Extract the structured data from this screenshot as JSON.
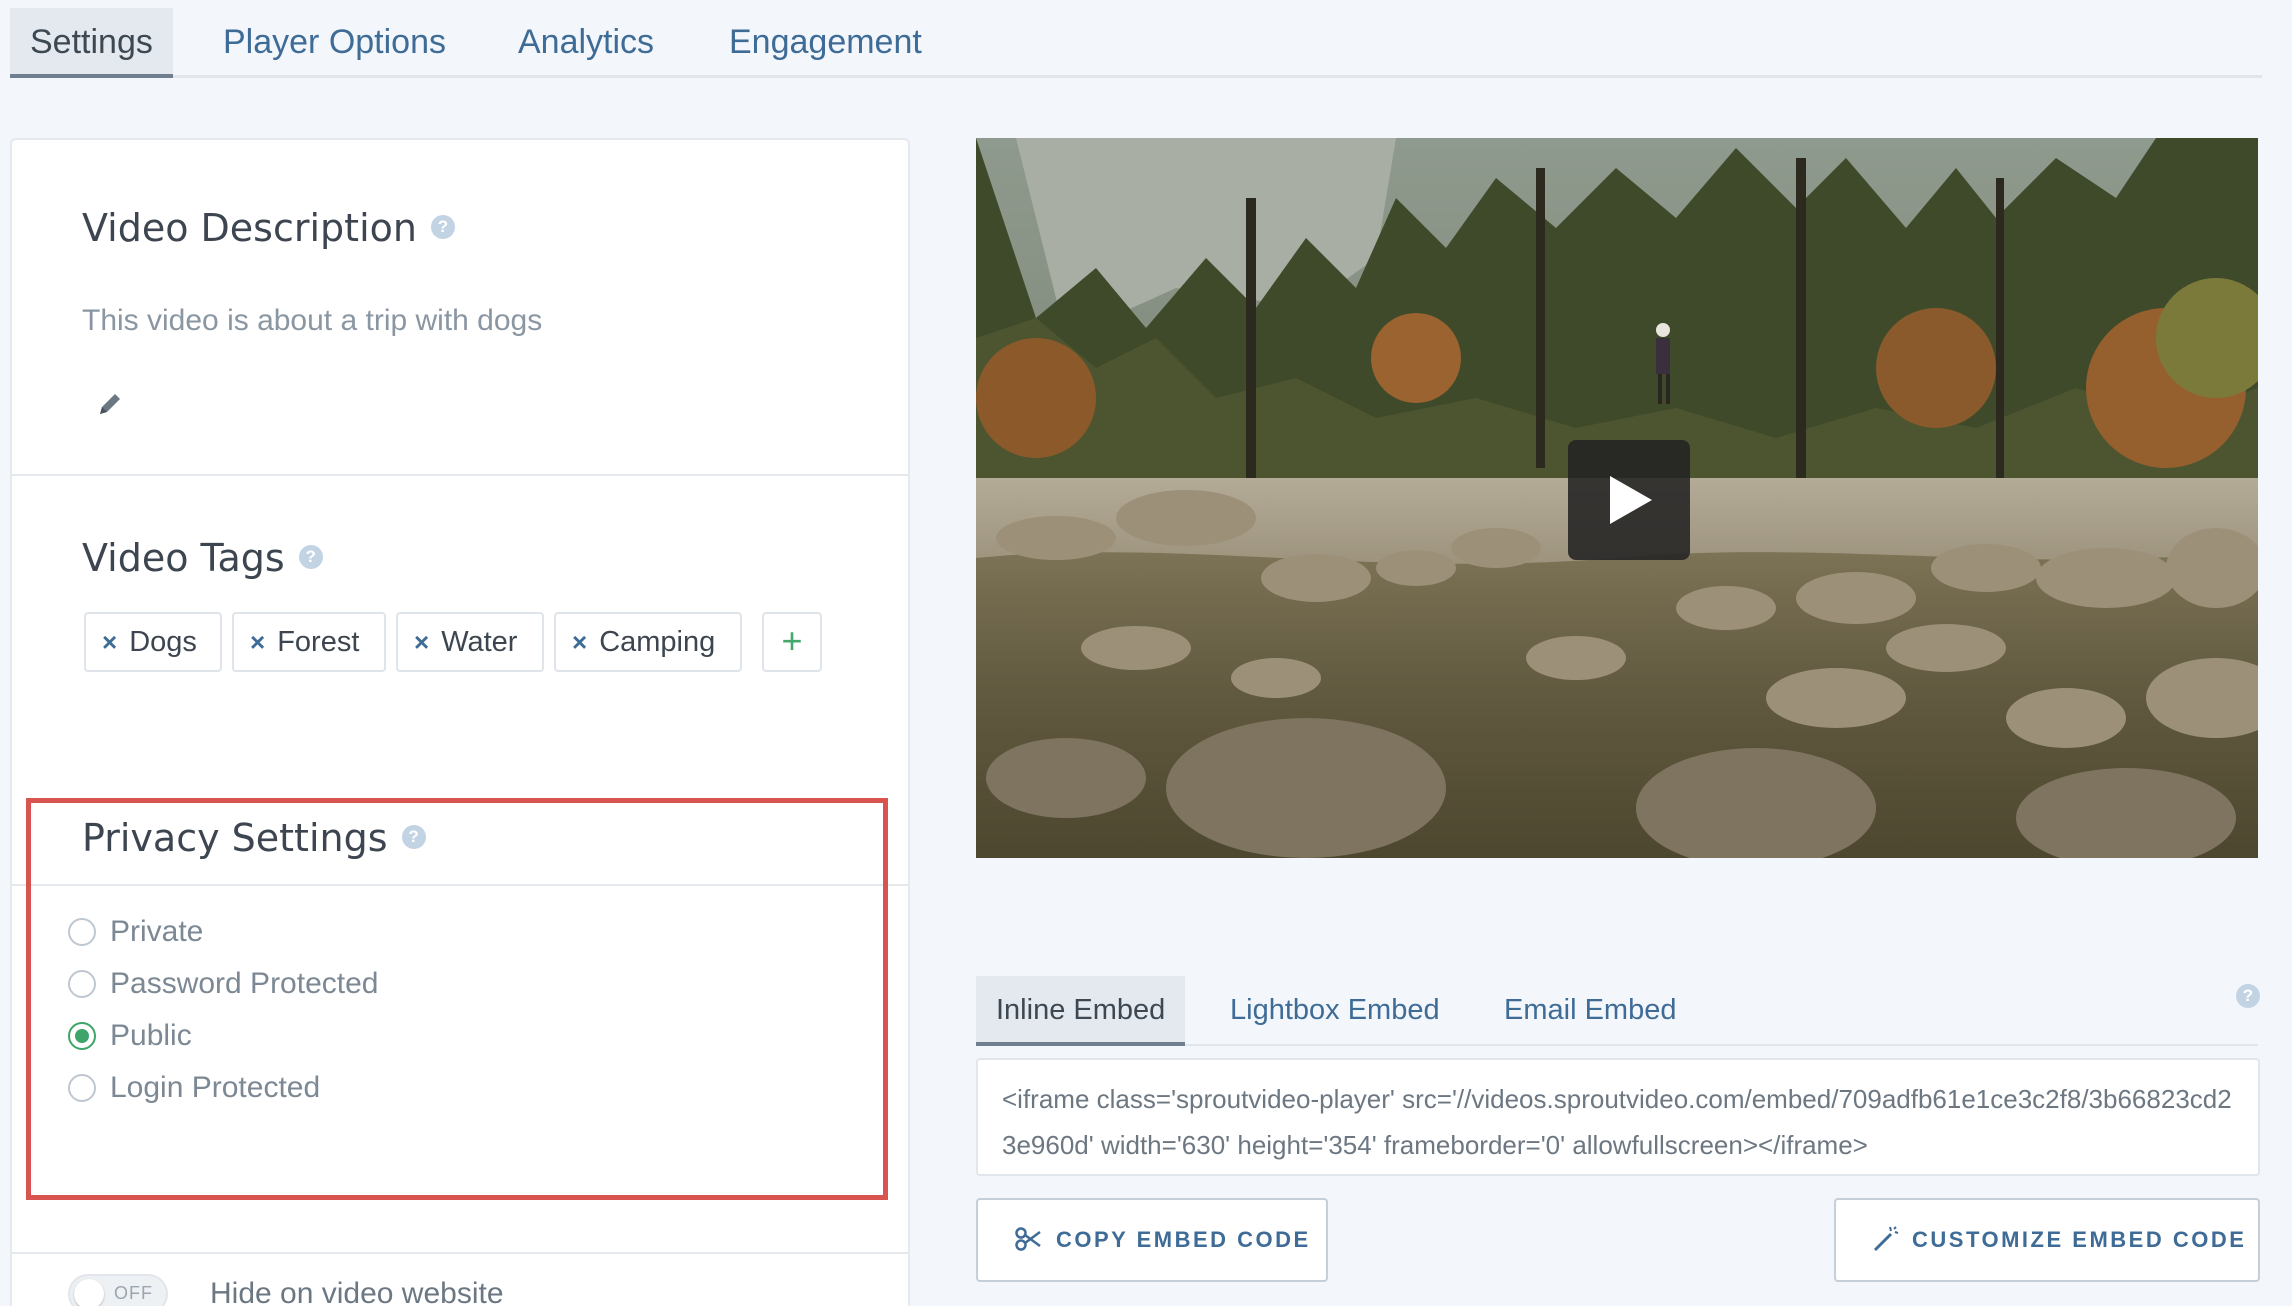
{
  "tabs": {
    "settings": "Settings",
    "player_options": "Player Options",
    "analytics": "Analytics",
    "engagement": "Engagement",
    "active": "Settings"
  },
  "description": {
    "title": "Video Description",
    "help": "?",
    "text": "This video is about a trip with dogs",
    "edit_icon": "pencil-icon"
  },
  "tags": {
    "title": "Video Tags",
    "help": "?",
    "remove_symbol": "×",
    "items": [
      "Dogs",
      "Forest",
      "Water",
      "Camping"
    ],
    "add_symbol": "+"
  },
  "privacy": {
    "title": "Privacy Settings",
    "help": "?",
    "options": [
      "Private",
      "Password Protected",
      "Public",
      "Login Protected"
    ],
    "selected": "Public",
    "toggle_state": "OFF",
    "toggle_label": "Hide on video website"
  },
  "video": {
    "play_icon": "play-icon"
  },
  "embed": {
    "tabs": [
      "Inline Embed",
      "Lightbox Embed",
      "Email Embed"
    ],
    "active_tab": "Inline Embed",
    "help": "?",
    "code": "<iframe class='sproutvideo-player' src='//videos.sproutvideo.com/embed/709adfb61e1ce3c2f8/3b66823cd23e960d' width='630' height='354' frameborder='0' allowfullscreen></iframe>",
    "copy_label": "COPY EMBED CODE",
    "customize_label": "CUSTOMIZE EMBED CODE"
  },
  "colors": {
    "link": "#3f6c97",
    "success_green": "#3fa46a",
    "highlight_red": "#d9534f",
    "background": "#f3f6fa"
  }
}
